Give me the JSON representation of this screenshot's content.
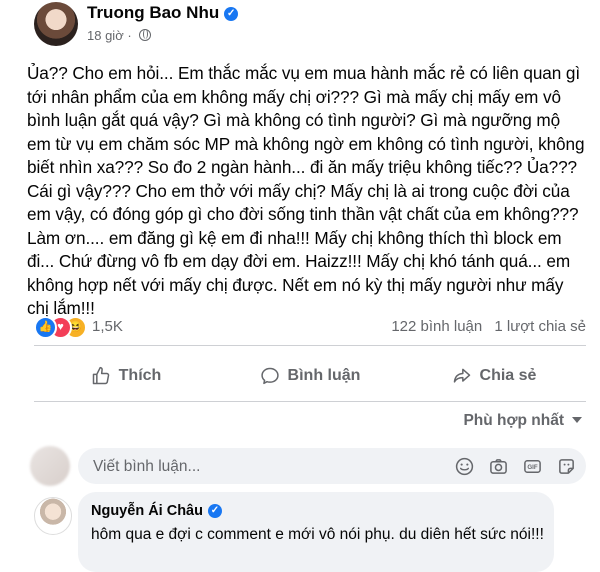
{
  "post": {
    "author": "Truong Bao Nhu",
    "time": "18 giờ",
    "dot": "·",
    "text": "Ủa?? Cho em hỏi... Em thắc mắc vụ em mua hành mắc rẻ có liên quan gì tới nhân phẩm của em không mấy chị ơi??? Gì mà mấy chị mấy em vô bình luận gắt quá vậy? Gì mà không có tình người? Gì mà ngưỡng mộ em từ vụ em chăm sóc MP mà không ngờ em không có tình người, không biết nhìn xa??? So đo 2 ngàn hành... đi ăn mấy triệu không tiếc?? Ủa??? Cái gì vậy??? Cho em thở với mấy chị? Mấy chị là ai trong cuộc đời của em vậy, có đóng góp gì cho đời sống tinh thần vật chất của em không??? Làm ơn.... em đăng gì kệ em đi nha!!! Mấy chị không thích thì block em đi... Chứ đừng vô fb em dạy đời em. Haizz!!! Mấy chị khó tánh quá... em không hợp nết với mấy chị được. Nết em nó kỳ thị mấy người như mấy chị lắm!!!"
  },
  "stats": {
    "reaction_count": "1,5K",
    "comments": "122 bình luận",
    "shares": "1 lượt chia sẻ"
  },
  "actions": {
    "like": "Thích",
    "comment": "Bình luận",
    "share": "Chia sẻ"
  },
  "sort": "Phù hợp nhất",
  "comment_input": {
    "placeholder": "Viết bình luận..."
  },
  "comment": {
    "name": "Nguyễn Ái Châu",
    "text": "hôm qua e đợi c comment e mới vô nói phụ. du diên hết sức nói!!!"
  },
  "colors": {
    "brand": "#1877f2",
    "muted": "#65676b",
    "love": "#f33e58",
    "wow": "#f7b125"
  }
}
